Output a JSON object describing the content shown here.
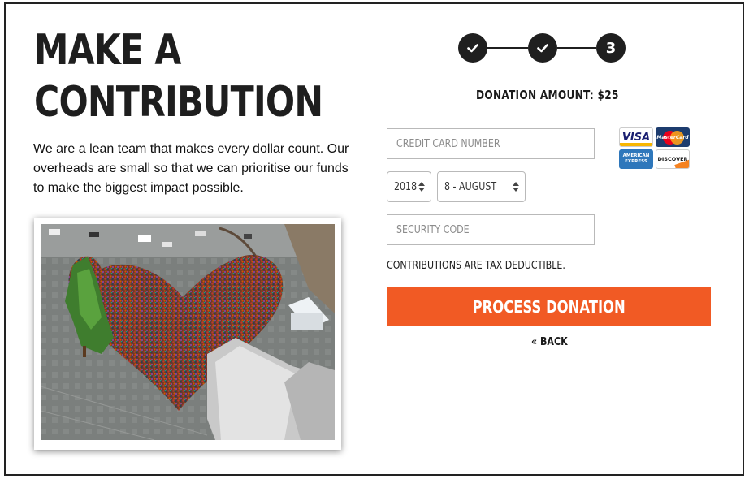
{
  "heading": {
    "line1": "MAKE A",
    "line2": "CONTRIBUTION"
  },
  "intro_text": "We are a lean team that makes every dollar count. Our overheads are small so that we can prioritise our funds to make the biggest impact possible.",
  "photo": {
    "icon": "crowd-heart-photo"
  },
  "steps": [
    {
      "label": "",
      "state": "done",
      "icon": "check-icon"
    },
    {
      "label": "",
      "state": "done",
      "icon": "check-icon"
    },
    {
      "label": "3",
      "state": "current",
      "icon": ""
    }
  ],
  "donation": {
    "amount_label": "DONATION AMOUNT: $25"
  },
  "form": {
    "card_number_placeholder": "CREDIT CARD NUMBER",
    "year_value": "2018",
    "month_value": "8 - AUGUST",
    "security_code_placeholder": "SECURITY CODE",
    "tax_note": "CONTRIBUTIONS ARE TAX DEDUCTIBLE.",
    "process_label": "PROCESS DONATION",
    "back_label": "« BACK"
  },
  "cards": {
    "visa": "VISA",
    "mastercard": "MasterCard",
    "amex": "AMERICAN EXPRESS",
    "discover": "DISCOVER"
  },
  "colors": {
    "accent": "#f15a24",
    "dark": "#1f1f1f"
  }
}
